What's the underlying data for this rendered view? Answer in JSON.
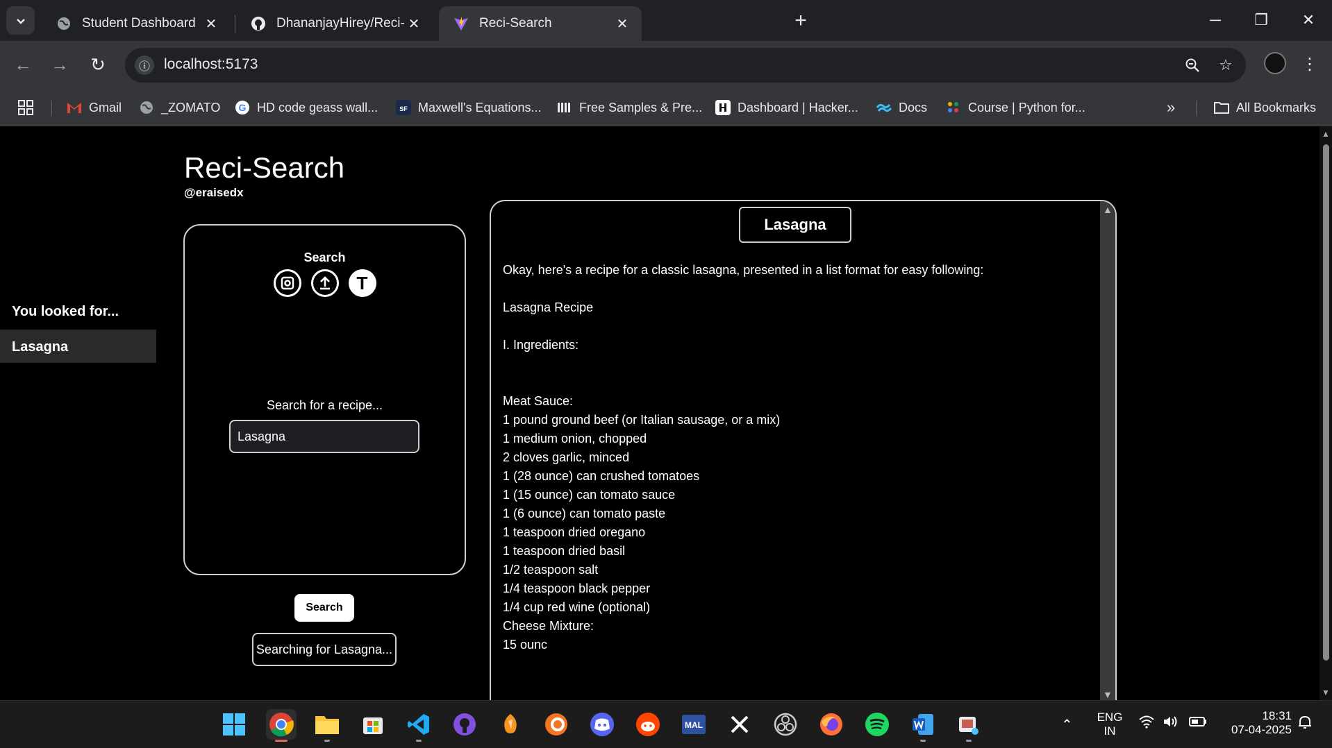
{
  "browser": {
    "tabs": [
      {
        "title": "Student Dashboard",
        "icon": "globe-icon"
      },
      {
        "title": "DhananjayHirey/Reci-Search: A",
        "icon": "github-icon"
      },
      {
        "title": "Reci-Search",
        "icon": "vite-icon"
      }
    ],
    "url": "localhost:5173",
    "bookmarks": [
      {
        "label": "Gmail",
        "icon": "gmail-icon"
      },
      {
        "label": "_ZOMATO",
        "icon": "globe-icon"
      },
      {
        "label": "HD code geass wall...",
        "icon": "google-icon"
      },
      {
        "label": "Maxwell's Equations...",
        "icon": "sf-icon"
      },
      {
        "label": "Free Samples & Pre...",
        "icon": "samples-icon"
      },
      {
        "label": "Dashboard | Hacker...",
        "icon": "hackerrank-icon"
      },
      {
        "label": "Docs",
        "icon": "tailwind-icon"
      },
      {
        "label": "Course | Python for...",
        "icon": "course-icon"
      }
    ],
    "all_bookmarks": "All Bookmarks"
  },
  "app": {
    "title": "Reci-Search",
    "handle": "@eraisedx"
  },
  "history": {
    "title": "You looked for...",
    "items": [
      "Lasagna"
    ]
  },
  "search": {
    "label": "Search",
    "modes": [
      {
        "icon": "camera-icon"
      },
      {
        "icon": "upload-icon"
      },
      {
        "icon": "text-icon",
        "glyph": "T"
      }
    ],
    "prompt": "Search for a recipe...",
    "value": "Lasagna",
    "button": "Search",
    "status": "Searching for Lasagna..."
  },
  "result": {
    "title": "Lasagna",
    "lines": [
      "Okay, here's a recipe for a classic lasagna, presented in a list format for easy following:",
      "",
      "Lasagna Recipe",
      "",
      "I. Ingredients:",
      "",
      "",
      "Meat Sauce:",
      "1 pound ground beef (or Italian sausage, or a mix)",
      "1 medium onion, chopped",
      "2 cloves garlic, minced",
      "1 (28 ounce) can crushed tomatoes",
      "1 (15 ounce) can tomato sauce",
      "1 (6 ounce) can tomato paste",
      "1 teaspoon dried oregano",
      "1 teaspoon dried basil",
      "1/2 teaspoon salt",
      "1/4 teaspoon black pepper",
      "1/4 cup red wine (optional)",
      "Cheese Mixture:",
      "15 ounc"
    ]
  },
  "taskbar": {
    "apps": [
      "windows-start-icon",
      "chrome-icon",
      "file-explorer-icon",
      "microsoft-store-icon",
      "vscode-icon",
      "github-desktop-icon",
      "fl-studio-icon",
      "crunchyroll-icon",
      "discord-icon",
      "reddit-icon",
      "myanimelist-icon",
      "x-icon",
      "obs-icon",
      "firefox-icon",
      "spotify-icon",
      "word-icon",
      "snipping-tool-icon"
    ],
    "mal_label": "MAL",
    "lang_line1": "ENG",
    "lang_line2": "IN",
    "time": "18:31",
    "date": "07-04-2025"
  }
}
